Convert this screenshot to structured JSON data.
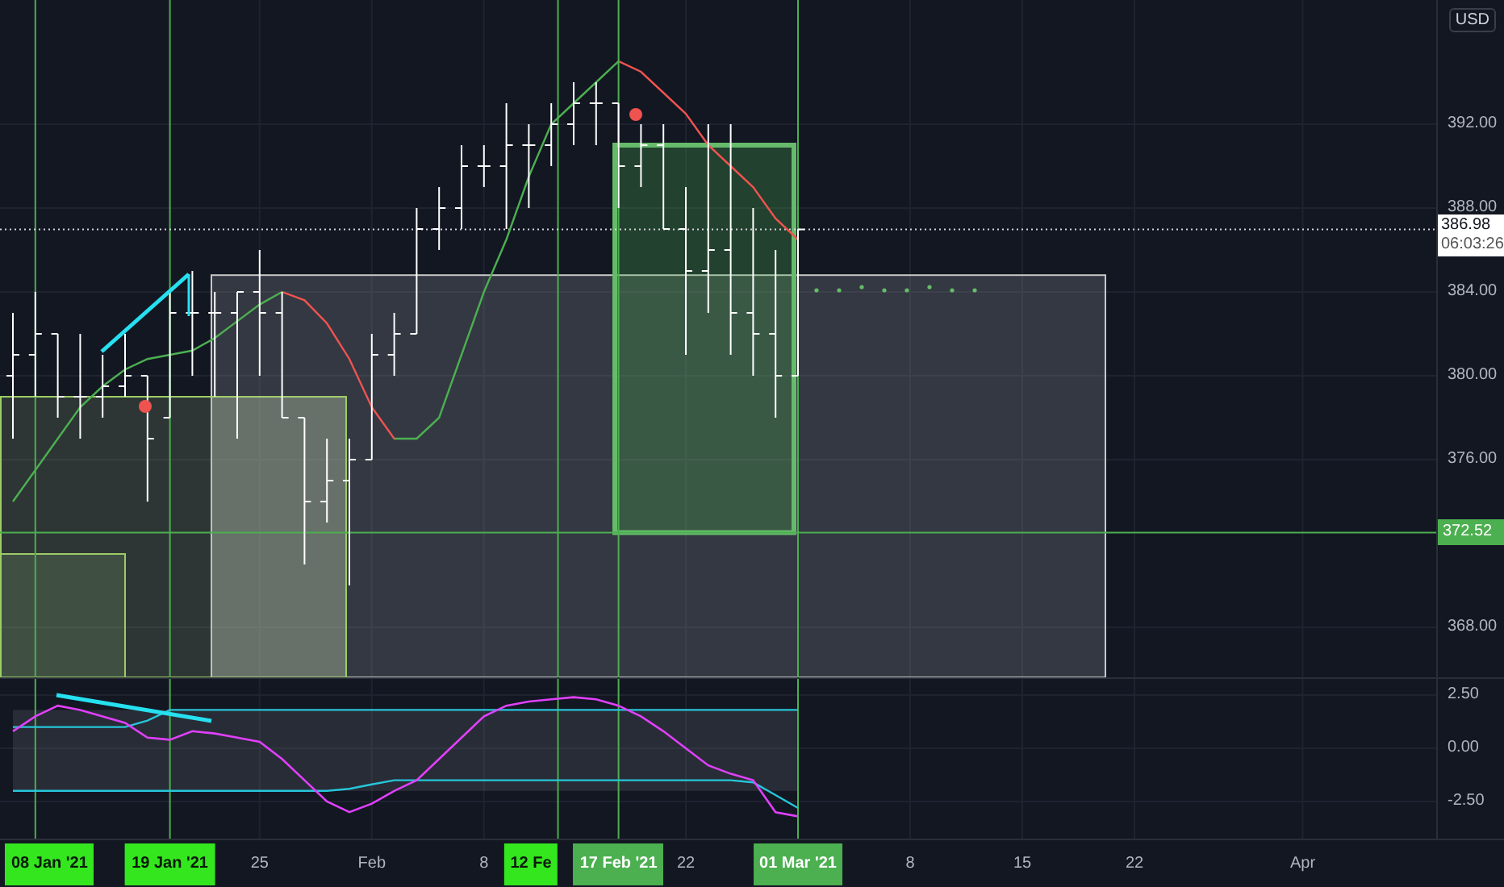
{
  "price_axis": {
    "currency": "USD",
    "ticks": [
      "392.00",
      "388.00",
      "384.00",
      "380.00",
      "376.00",
      "368.00"
    ],
    "last_price": "386.98",
    "countdown": "06:03:26",
    "line_price": "372.52"
  },
  "oscillator_axis": {
    "ticks": [
      "2.50",
      "0.00",
      "-2.50"
    ]
  },
  "time_axis": {
    "labels": [
      {
        "label": "08 Jan '21",
        "highlighted": true,
        "color": "#33e61d"
      },
      {
        "label": "19 Jan '21",
        "highlighted": true,
        "color": "#33e61d"
      },
      {
        "label": "25",
        "highlighted": false
      },
      {
        "label": "Feb",
        "highlighted": false
      },
      {
        "label": "8",
        "highlighted": false
      },
      {
        "label": "12 Fe",
        "highlighted": true,
        "color": "#33e61d"
      },
      {
        "label": "17 Feb '21",
        "highlighted": true,
        "color": "#4caf50"
      },
      {
        "label": "22",
        "highlighted": false
      },
      {
        "label": "01 Mar '21",
        "highlighted": true,
        "color": "#4caf50"
      },
      {
        "label": "8",
        "highlighted": false
      },
      {
        "label": "15",
        "highlighted": false
      },
      {
        "label": "22",
        "highlighted": false
      },
      {
        "label": "Apr",
        "highlighted": false
      }
    ]
  }
}
